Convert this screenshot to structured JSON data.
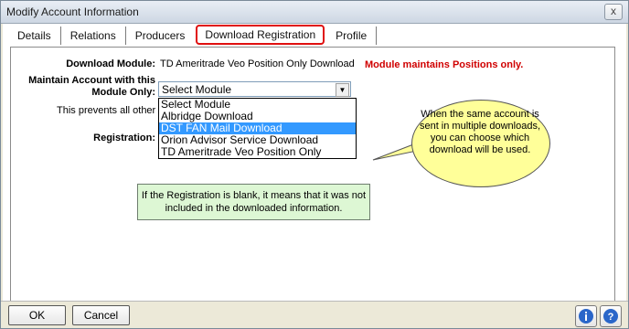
{
  "window": {
    "title": "Modify Account Information",
    "close_label": "x"
  },
  "tabs": [
    "Details",
    "Relations",
    "Producers",
    "Download Registration",
    "Profile"
  ],
  "form": {
    "download_module_label": "Download Module:",
    "download_module_value": "TD Ameritrade Veo Position Only Download",
    "positions_note": "Module maintains Positions only.",
    "maintain_label_1": "Maintain Account with this",
    "maintain_label_2": "Module Only:",
    "select_value": "Select Module",
    "prevents_text": "This prevents all other D",
    "registration_label": "Registration:"
  },
  "dropdown_options": [
    "Select Module",
    "Albridge Download",
    "DST FAN Mail Download",
    "Orion Advisor Service Download",
    "TD Ameritrade Veo Position Only"
  ],
  "selected_option_index": 2,
  "callout": {
    "text": "When the same account is sent in multiple downloads, you can choose which download will be used."
  },
  "note": {
    "text": "If the Registration is blank, it means that it was not included in the downloaded information."
  },
  "buttons": {
    "ok": "OK",
    "cancel": "Cancel"
  },
  "icons": [
    "info-icon",
    "help-icon"
  ]
}
